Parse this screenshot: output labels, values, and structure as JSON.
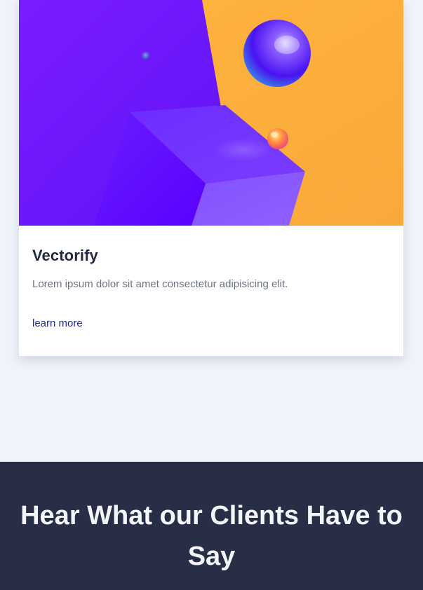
{
  "card": {
    "title": "Vectorify",
    "description": "Lorem ipsum dolor sit amet consectetur adipisicing elit.",
    "link_label": "learn more",
    "image_name": "abstract-3d-shapes-illustration",
    "colors": {
      "purple": "#6c1cff",
      "orange": "#fdb03a",
      "link": "#1b2aa0",
      "title": "#232a3f"
    }
  },
  "testimonials": {
    "heading": "Hear What our Clients Have to Say",
    "background": "#282e45"
  }
}
